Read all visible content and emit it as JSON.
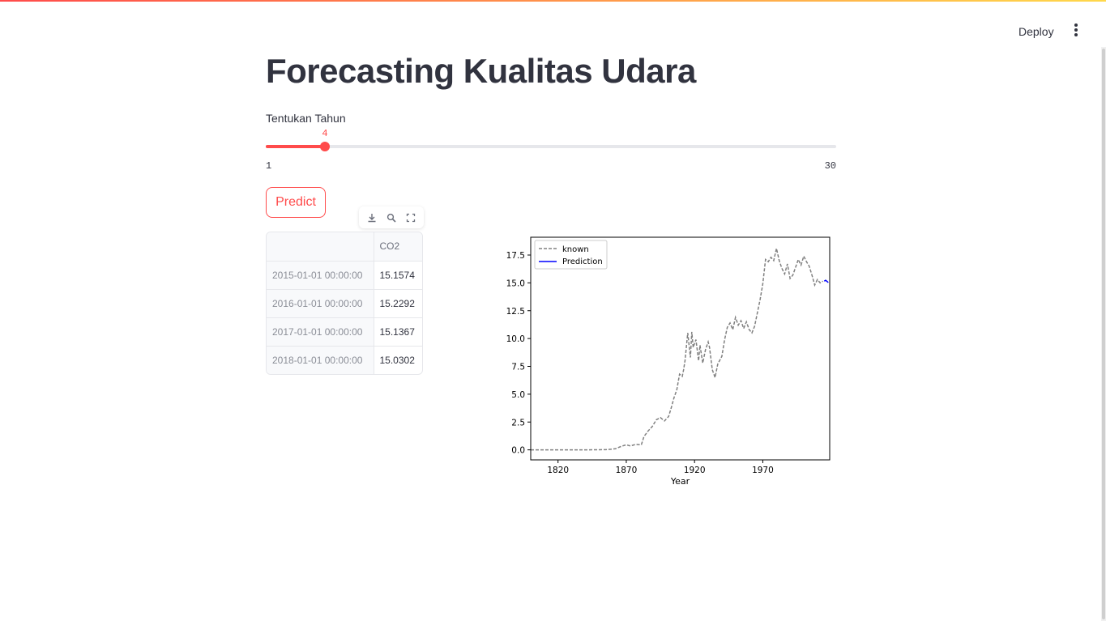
{
  "header": {
    "deploy_label": "Deploy"
  },
  "main": {
    "title": "Forecasting Kualitas Udara",
    "slider": {
      "label": "Tentukan Tahun",
      "value": "4",
      "min": "1",
      "max": "30",
      "accent_color": "#ff4b4b"
    },
    "predict_label": "Predict",
    "table": {
      "columns": [
        "",
        "CO2"
      ],
      "rows": [
        [
          "2015-01-01 00:00:00",
          "15.1574"
        ],
        [
          "2016-01-01 00:00:00",
          "15.2292"
        ],
        [
          "2017-01-01 00:00:00",
          "15.1367"
        ],
        [
          "2018-01-01 00:00:00",
          "15.0302"
        ]
      ],
      "toolbar_icons": [
        "download-icon",
        "search-icon",
        "fullscreen-icon"
      ]
    }
  },
  "chart_data": {
    "type": "line",
    "title": "",
    "xlabel": "Year",
    "ylabel": "",
    "xlim": [
      1800,
      2019
    ],
    "ylim": [
      -0.9,
      19.1
    ],
    "xticks": [
      "1820",
      "1870",
      "1920",
      "1970"
    ],
    "yticks": [
      "0.0",
      "2.5",
      "5.0",
      "7.5",
      "10.0",
      "12.5",
      "15.0",
      "17.5"
    ],
    "legend_position": "upper-left",
    "series": [
      {
        "name": "known",
        "style": "dashed",
        "color": "#808080",
        "x": [
          1800,
          1820,
          1840,
          1855,
          1862,
          1866,
          1870,
          1873,
          1877,
          1881,
          1883,
          1886,
          1889,
          1892,
          1895,
          1898,
          1901,
          1903,
          1905,
          1907,
          1909,
          1911,
          1912,
          1913,
          1915,
          1917,
          1918,
          1919,
          1921,
          1923,
          1924,
          1926,
          1928,
          1930,
          1931,
          1933,
          1935,
          1937,
          1940,
          1942,
          1944,
          1946,
          1948,
          1950,
          1952,
          1954,
          1956,
          1958,
          1960,
          1962,
          1964,
          1966,
          1968,
          1970,
          1972,
          1974,
          1976,
          1978,
          1980,
          1982,
          1984,
          1986,
          1988,
          1990,
          1992,
          1994,
          1996,
          1998,
          2000,
          2002,
          2004,
          2006,
          2008,
          2010,
          2012,
          2014
        ],
        "y": [
          0.0,
          0.0,
          0.0,
          0.02,
          0.1,
          0.3,
          0.45,
          0.35,
          0.5,
          0.45,
          1.2,
          1.7,
          2.1,
          2.7,
          2.9,
          2.6,
          3.0,
          3.8,
          4.7,
          5.4,
          6.8,
          6.6,
          7.2,
          8.0,
          10.5,
          8.3,
          10.6,
          9.2,
          9.9,
          8.0,
          9.4,
          7.8,
          9.0,
          9.7,
          9.2,
          7.2,
          6.5,
          7.7,
          8.4,
          9.9,
          11.0,
          11.4,
          10.8,
          11.9,
          11.2,
          11.6,
          10.9,
          11.5,
          10.8,
          10.5,
          11.1,
          12.3,
          13.5,
          14.9,
          17.1,
          16.9,
          17.3,
          17.0,
          18.1,
          17.0,
          16.3,
          15.8,
          16.7,
          15.4,
          15.7,
          16.4,
          17.1,
          16.6,
          17.4,
          16.9,
          16.5,
          15.7,
          14.8,
          15.3,
          15.0,
          15.16
        ]
      },
      {
        "name": "Prediction",
        "style": "solid",
        "color": "#0000ff",
        "x": [
          2015,
          2016,
          2017,
          2018
        ],
        "y": [
          15.1574,
          15.2292,
          15.1367,
          15.0302
        ]
      }
    ]
  }
}
